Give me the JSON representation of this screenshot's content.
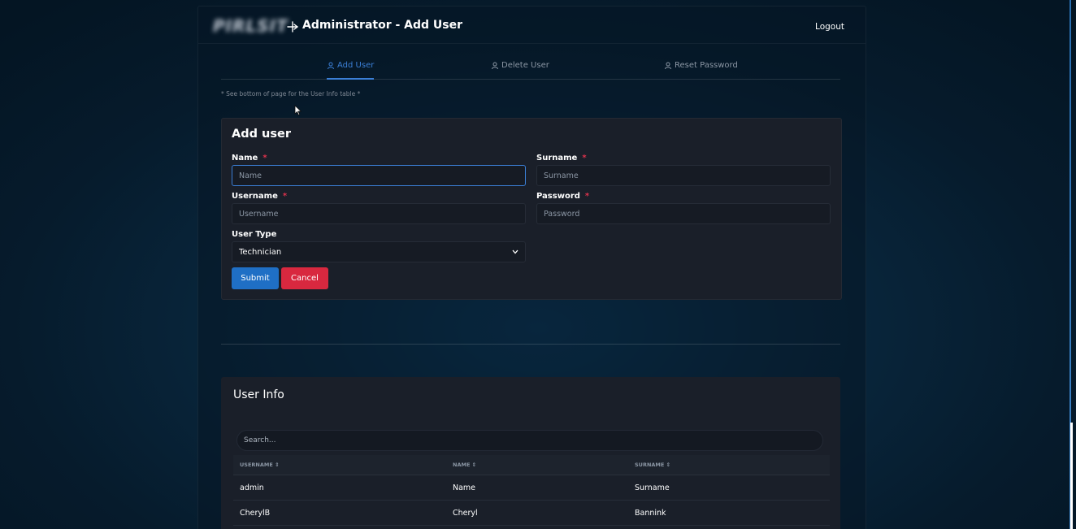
{
  "header": {
    "logo_text": "PIRLSIT",
    "title": "Administrator - Add User",
    "logout_label": "Logout"
  },
  "tabs": [
    {
      "label": "Add User",
      "icon": "user-plus-icon",
      "active": true
    },
    {
      "label": "Delete User",
      "icon": "user-minus-icon",
      "active": false
    },
    {
      "label": "Reset Password",
      "icon": "user-key-icon",
      "active": false
    }
  ],
  "note": "* See bottom of page for the User Info table *",
  "form": {
    "title": "Add user",
    "name_label": "Name",
    "name_placeholder": "Name",
    "surname_label": "Surname",
    "surname_placeholder": "Surname",
    "username_label": "Username",
    "username_placeholder": "Username",
    "password_label": "Password",
    "password_placeholder": "Password",
    "user_type_label": "User Type",
    "user_type_value": "Technician",
    "required_mark": "*",
    "submit_label": "Submit",
    "cancel_label": "Cancel"
  },
  "user_info": {
    "title": "User Info",
    "search_placeholder": "Search...",
    "columns": [
      "USERNAME",
      "NAME",
      "SURNAME"
    ],
    "sort_glyph": "⇕",
    "rows": [
      {
        "username": "admin",
        "name": "Name",
        "surname": "Surname"
      },
      {
        "username": "CherylB",
        "name": "Cheryl",
        "surname": "Bannink"
      }
    ]
  },
  "colors": {
    "accent": "#3b7fd6",
    "submit": "#1f6fc5",
    "cancel": "#d8283f",
    "required": "#e0334d"
  }
}
